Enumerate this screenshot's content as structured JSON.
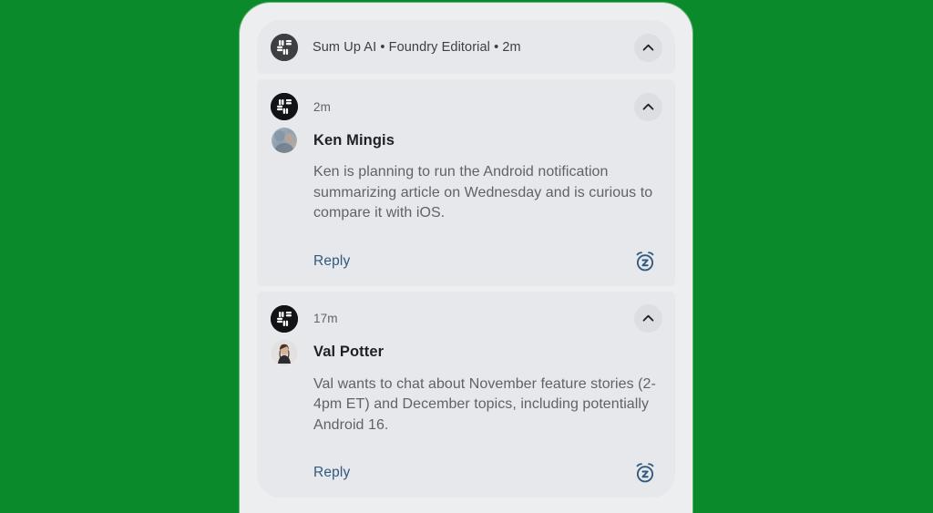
{
  "background": {
    "color": "#0b8a2c"
  },
  "theme": {
    "card_bg": "#e6e8eb",
    "frame_bg": "#eceef0",
    "accent_link": "#31597e",
    "app_icon_bg": "#3c4043"
  },
  "notification_shade": {
    "summary_header": {
      "app_icon": "slack-hash-icon",
      "title": "Sum Up AI • Foundry Editorial • 2m",
      "collapse_icon": "chevron-up-icon"
    },
    "groups": [
      {
        "app_icon": "slack-hash-icon",
        "timestamp": "2m",
        "collapse_icon": "chevron-up-icon",
        "avatar": "ken-mingis-avatar",
        "sender": "Ken Mingis",
        "message": "Ken is planning to run the Android notification summarizing article on Wednesday and is curious to compare it with iOS.",
        "reply_label": "Reply",
        "snooze_icon": "snooze-alarm-icon"
      },
      {
        "app_icon": "slack-hash-icon",
        "timestamp": "17m",
        "collapse_icon": "chevron-up-icon",
        "avatar": "val-potter-avatar",
        "sender": "Val Potter",
        "message": "Val wants to chat about November feature stories (2-4pm ET) and December topics, including potentially Android 16.",
        "reply_label": "Reply",
        "snooze_icon": "snooze-alarm-icon"
      }
    ]
  }
}
